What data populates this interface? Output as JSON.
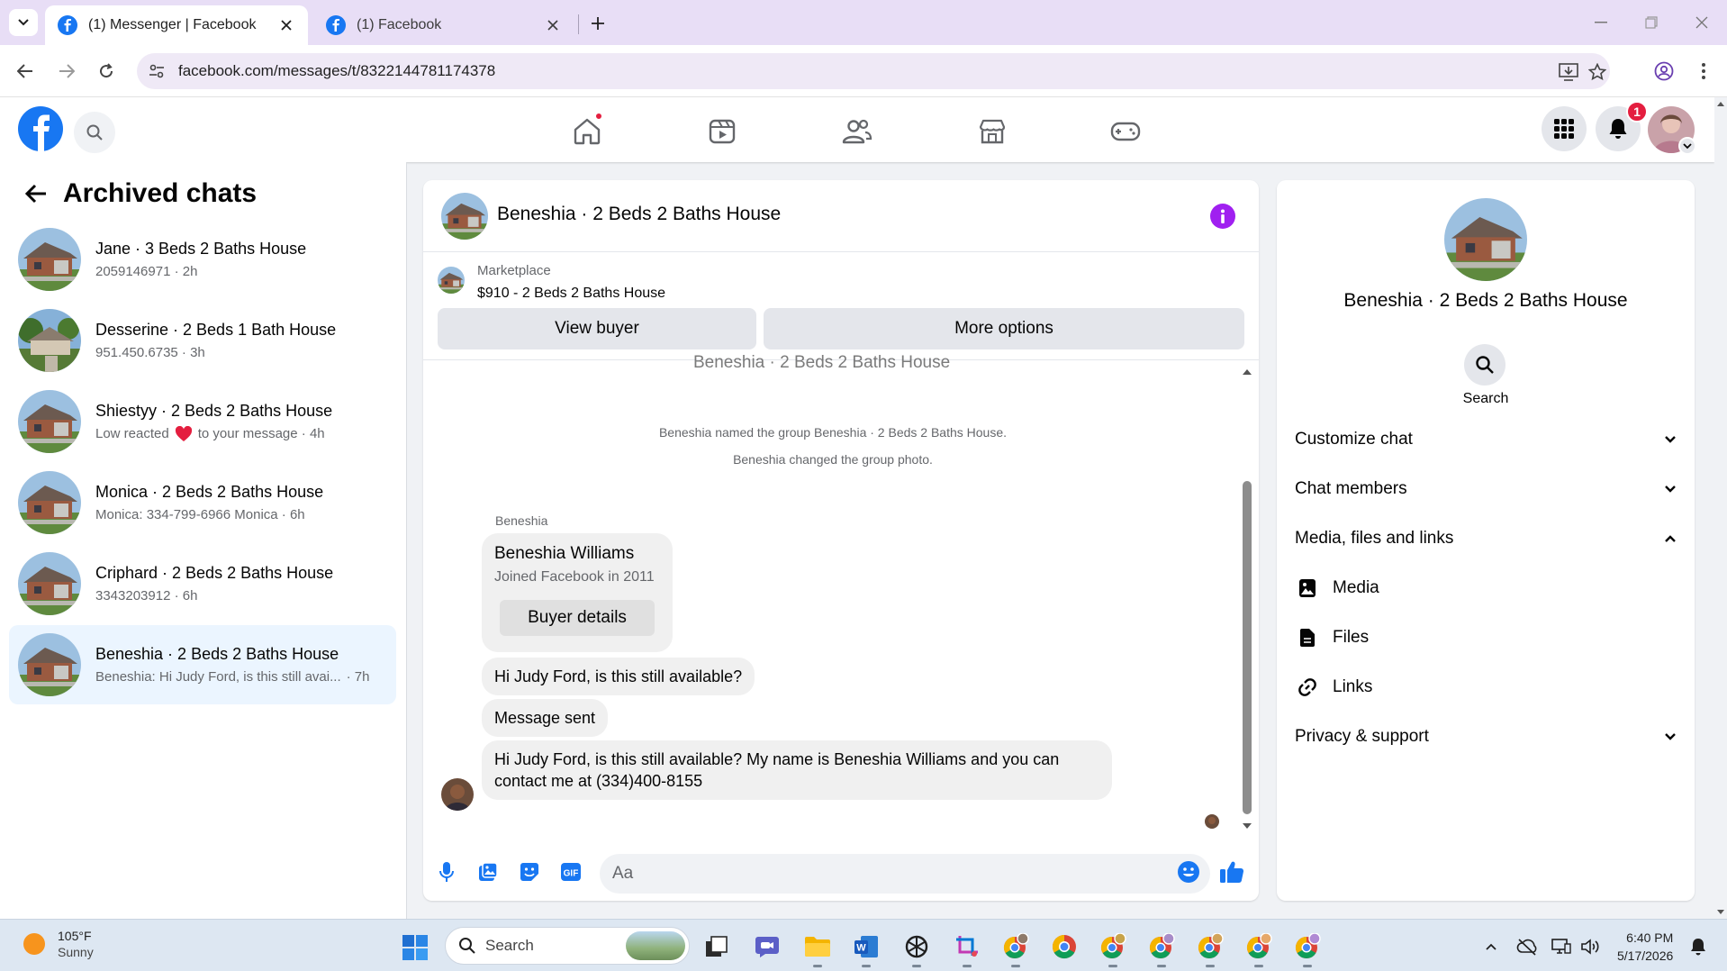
{
  "browser": {
    "tabs": [
      {
        "title": "(1) Messenger | Facebook",
        "active": true
      },
      {
        "title": "(1) Facebook",
        "active": false
      }
    ],
    "url": "facebook.com/messages/t/8322144781174378"
  },
  "header": {
    "notification_count": "1",
    "nav": [
      "home-icon",
      "video-icon",
      "friends-icon",
      "marketplace-icon",
      "gaming-icon"
    ]
  },
  "sidebar": {
    "title": "Archived chats",
    "chats": [
      {
        "name": "Jane · 3 Beds 2 Baths House",
        "preview": "2059146971 · 2h"
      },
      {
        "name": "Desserine · 2 Beds 1 Bath House",
        "preview": "951.450.6735 · 3h"
      },
      {
        "name": "Shiestyy · 2 Beds 2 Baths House",
        "preview_pre": "Low reacted",
        "preview_post": "to your message · 4h"
      },
      {
        "name": "Monica · 2 Beds 2 Baths House",
        "preview": "Monica: 334-799-6966 Monica · 6h"
      },
      {
        "name": "Criphard · 2 Beds 2 Baths House",
        "preview": "3343203912 · 6h"
      },
      {
        "name": "Beneshia · 2 Beds 2 Baths House",
        "preview": "Beneshia: Hi Judy Ford, is this still avai...",
        "time": "· 7h",
        "selected": true
      }
    ]
  },
  "conversation": {
    "title": "Beneshia · 2 Beds 2 Baths House",
    "marketplace_label": "Marketplace",
    "listing": "$910 - 2 Beds 2 Baths House",
    "view_buyer": "View buyer",
    "more_options": "More options",
    "clipped_title": "Beneshia · 2 Beds 2 Baths House",
    "system_messages": [
      "Beneshia named the group Beneshia · 2 Beds 2 Baths House.",
      "Beneshia changed the group photo."
    ],
    "sender": "Beneshia",
    "card": {
      "name": "Beneshia Williams",
      "joined": "Joined Facebook in 2011",
      "button": "Buyer details"
    },
    "messages": [
      "Hi Judy Ford, is this still available?",
      "Message sent",
      "Hi Judy Ford, is this still available? My name is Beneshia Williams and you can contact me at (334)400-8155"
    ],
    "composer_placeholder": "Aa"
  },
  "info_panel": {
    "name": "Beneshia · 2 Beds 2 Baths House",
    "search_label": "Search",
    "sections": [
      "Customize chat",
      "Chat members",
      "Media, files and links"
    ],
    "media_items": [
      "Media",
      "Files",
      "Links"
    ],
    "privacy": "Privacy & support"
  },
  "taskbar": {
    "temperature": "105°F",
    "condition": "Sunny",
    "search": "Search",
    "time": "6:40 PM",
    "date": "5/17/2026"
  },
  "colors": {
    "facebook_blue": "#1877f2",
    "selected_chat": "#ebf5ff",
    "info_purple": "#a020f0",
    "badge_red": "#e41e3f"
  }
}
